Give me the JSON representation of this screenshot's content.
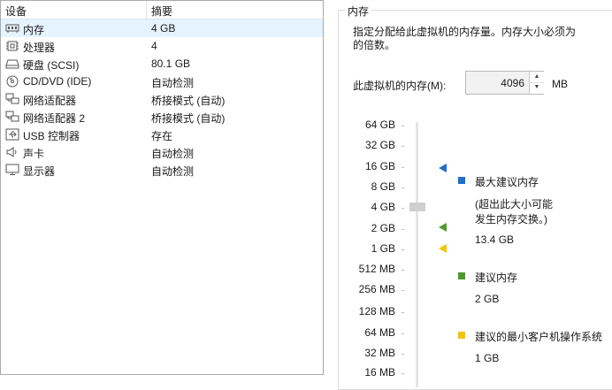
{
  "device_list": {
    "headers": {
      "device": "设备",
      "summary": "摘要"
    },
    "rows": [
      {
        "icon": "memory-icon",
        "name": "内存",
        "summary": "4 GB",
        "selected": true
      },
      {
        "icon": "processor-icon",
        "name": "处理器",
        "summary": "4"
      },
      {
        "icon": "hard-disk-icon",
        "name": "硬盘 (SCSI)",
        "summary": "80.1 GB"
      },
      {
        "icon": "cd-dvd-icon",
        "name": "CD/DVD (IDE)",
        "summary": "自动检测"
      },
      {
        "icon": "network-adapter-icon",
        "name": "网络适配器",
        "summary": "桥接模式 (自动)"
      },
      {
        "icon": "network-adapter-icon",
        "name": "网络适配器 2",
        "summary": "桥接模式 (自动)"
      },
      {
        "icon": "usb-controller-icon",
        "name": "USB 控制器",
        "summary": "存在"
      },
      {
        "icon": "sound-card-icon",
        "name": "声卡",
        "summary": "自动检测"
      },
      {
        "icon": "display-icon",
        "name": "显示器",
        "summary": "自动检测"
      }
    ]
  },
  "memory": {
    "group_title": "内存",
    "description_line1": "指定分配给此虚拟机的内存量。内存大小必须为",
    "description_line2": "的倍数。",
    "field_label": "此虚拟机的内存(M):",
    "value": "4096",
    "unit": "MB",
    "scale_labels": [
      "64 GB",
      "32 GB",
      "16 GB",
      "8 GB",
      "4 GB",
      "2 GB",
      "1 GB",
      "512 MB",
      "256 MB",
      "128 MB",
      "64 MB",
      "32 MB",
      "16 MB"
    ],
    "slider_value": "4 GB",
    "legend": {
      "max_recommended": {
        "label": "最大建议内存",
        "note_line1": "(超出此大小可能",
        "note_line2": "发生内存交换。)",
        "value": "13.4 GB",
        "color": "#1e6fc7"
      },
      "recommended": {
        "label": "建议内存",
        "value": "2 GB",
        "color": "#4d9a2a"
      },
      "min_guest_os": {
        "label": "建议的最小客户机操作系统",
        "value": "1 GB",
        "color": "#f2c500"
      }
    }
  }
}
